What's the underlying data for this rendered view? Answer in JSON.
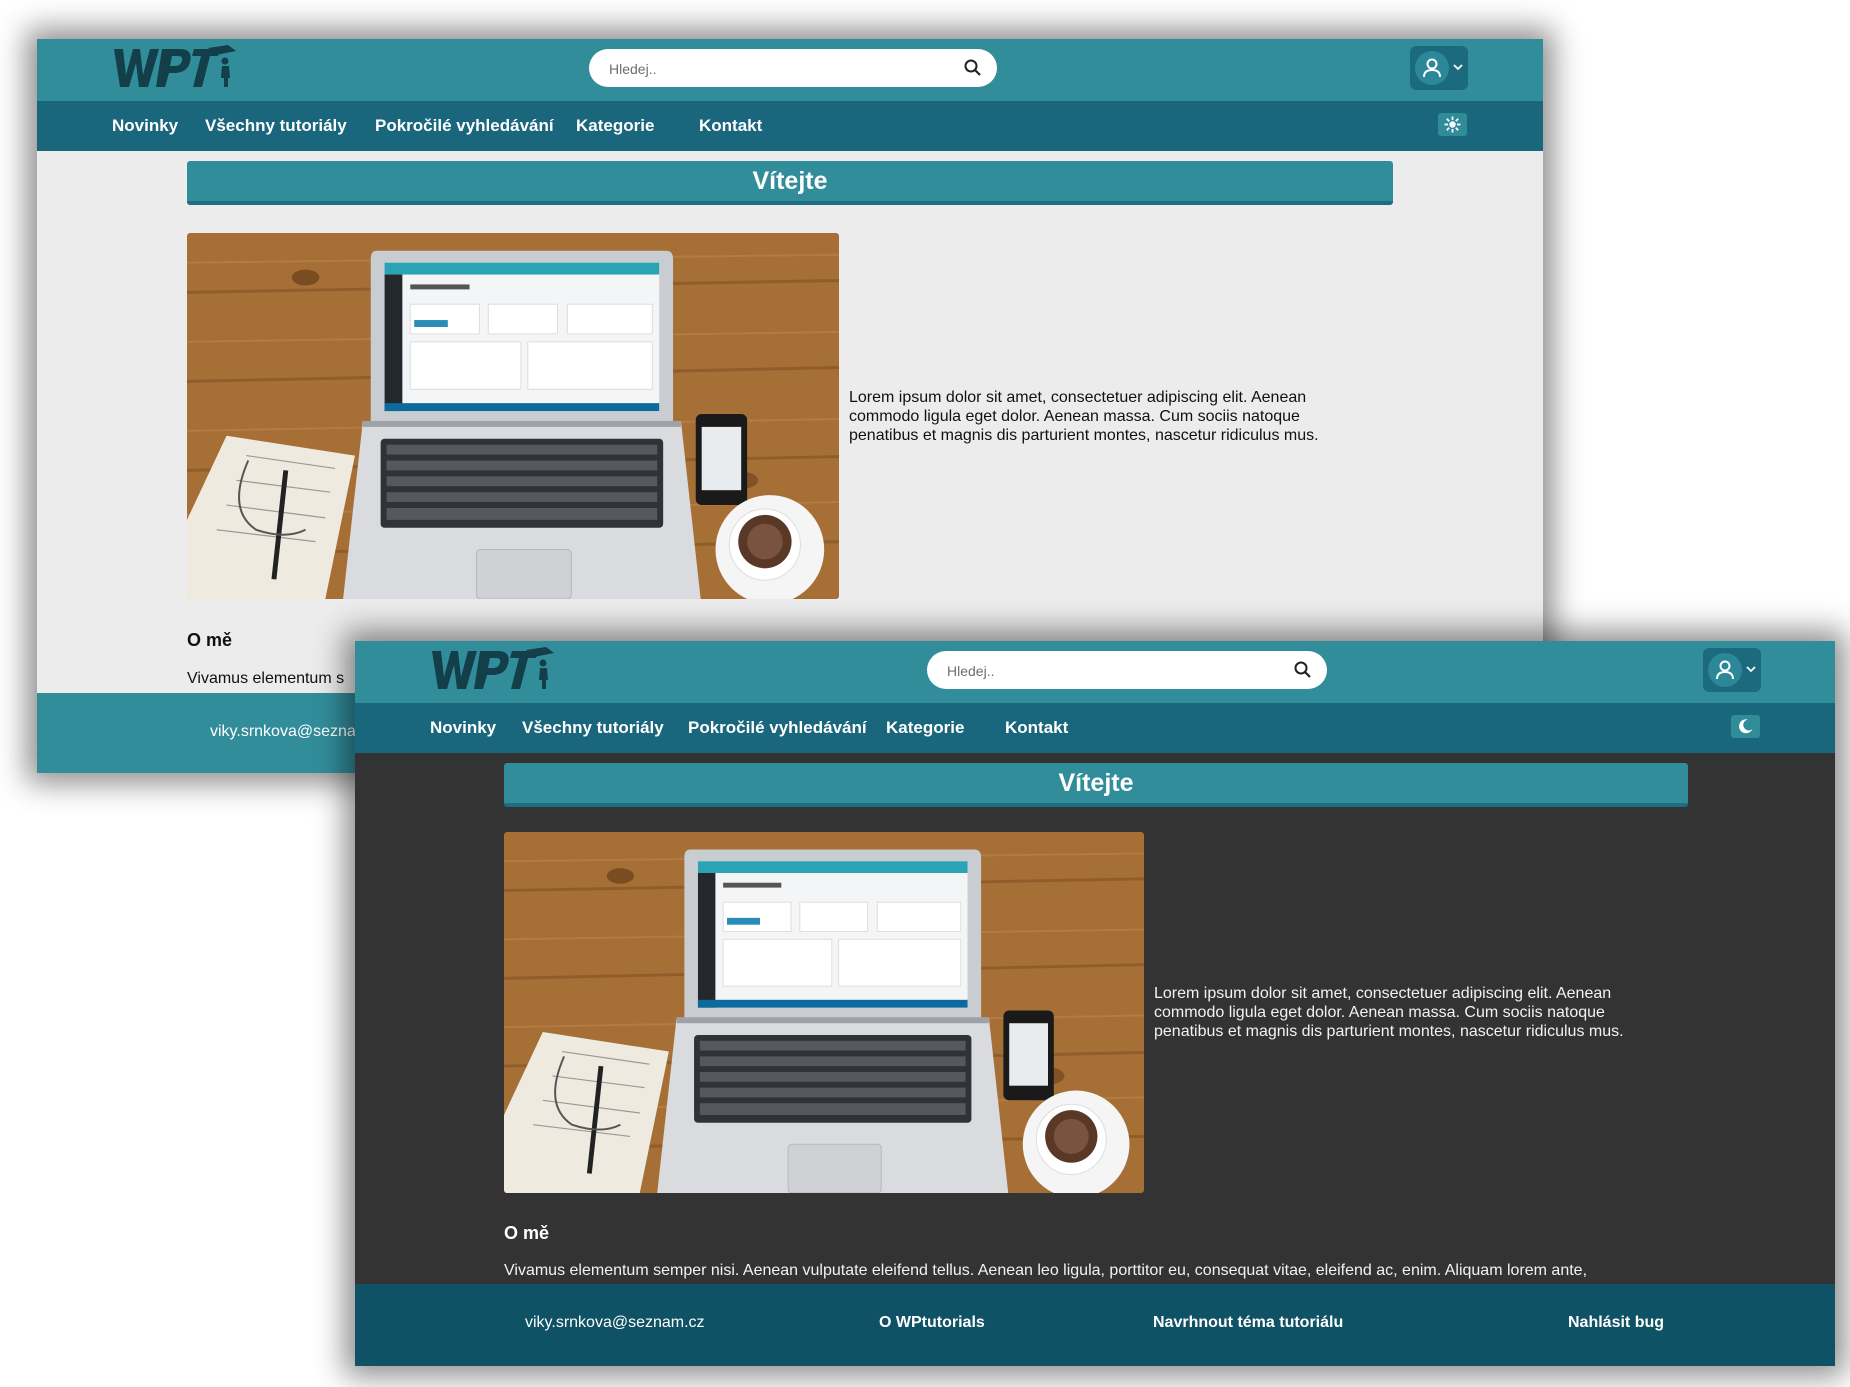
{
  "light": {
    "search": {
      "placeholder": "Hledej.."
    },
    "nav": [
      "Novinky",
      "Všechny tutoriály",
      "Pokročilé vyhledávání",
      "Kategorie",
      "Kontakt"
    ],
    "theme_icon": "sun-icon",
    "welcome": "Vítejte",
    "lorem": "Lorem ipsum dolor sit amet, consectetuer adipiscing elit. Aenean commodo ligula eget dolor. Aenean massa. Cum sociis natoque penatibus et magnis dis parturient montes, nascetur ridiculus mus.",
    "about_title": "O mě",
    "about_text": "Vivamus elementum s",
    "footer": {
      "email": "viky.srnkova@sezna"
    }
  },
  "dark": {
    "search": {
      "placeholder": "Hledej.."
    },
    "nav": [
      "Novinky",
      "Všechny tutoriály",
      "Pokročilé vyhledávání",
      "Kategorie",
      "Kontakt"
    ],
    "theme_icon": "moon-icon",
    "welcome": "Vítejte",
    "lorem": "Lorem ipsum dolor sit amet, consectetuer adipiscing elit. Aenean commodo ligula eget dolor. Aenean massa. Cum sociis natoque penatibus et magnis dis parturient montes, nascetur ridiculus mus.",
    "about_title": "O mě",
    "about_text": "Vivamus elementum semper nisi. Aenean vulputate eleifend tellus. Aenean leo ligula, porttitor eu, consequat vitae, eleifend ac, enim. Aliquam lorem ante,",
    "footer": {
      "email": "viky.srnkova@seznam.cz",
      "about": "O WPtutorials",
      "suggest": "Navrhnout téma tutoriálu",
      "bug": "Nahlásit bug"
    }
  },
  "colors": {
    "header": "#328d9b",
    "nav": "#19667d",
    "footer_light": "#328d9b",
    "footer_dark": "#0f5265",
    "light_bg": "#ececec",
    "dark_bg": "#333333"
  }
}
